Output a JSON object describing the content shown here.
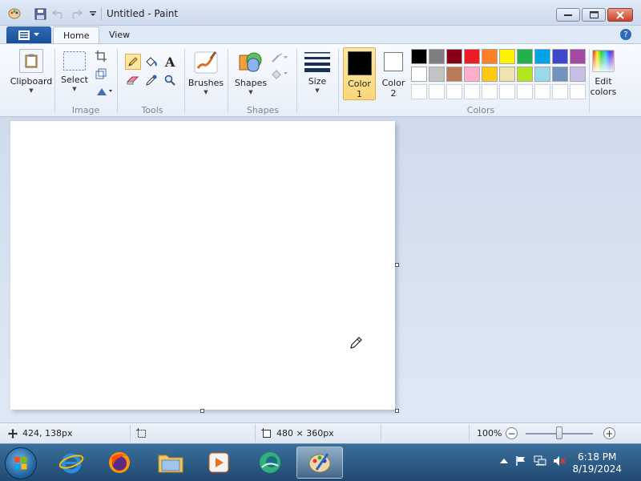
{
  "window": {
    "title": "Untitled - Paint"
  },
  "tabs": [
    {
      "label": "Home",
      "active": true
    },
    {
      "label": "View",
      "active": false
    }
  ],
  "ribbon": {
    "clipboard": {
      "label": "Clipboard"
    },
    "image": {
      "select_label": "Select",
      "group_label": "Image"
    },
    "tools": {
      "group_label": "Tools",
      "selected_tool": "pencil"
    },
    "brushes": {
      "label": "Brushes"
    },
    "shapes": {
      "label": "Shapes",
      "group_label": "Shapes"
    },
    "size": {
      "label": "Size"
    },
    "colors": {
      "color1_label": "Color\n1",
      "color2_label": "Color\n2",
      "color1_value": "#000000",
      "color2_value": "#ffffff",
      "edit_label": "Edit\ncolors",
      "group_label": "Colors",
      "palette_row1": [
        "#000000",
        "#7f7f7f",
        "#880015",
        "#ed1c24",
        "#ff7f27",
        "#fff200",
        "#22b14c",
        "#00a2e8",
        "#3f48cc",
        "#a349a4"
      ],
      "palette_row2": [
        "#ffffff",
        "#c3c3c3",
        "#b97a57",
        "#ffaec9",
        "#ffc90e",
        "#efe4b0",
        "#b5e61d",
        "#99d9ea",
        "#7092be",
        "#c8bfe7"
      ],
      "palette_row3": [
        "#ffffff",
        "#ffffff",
        "#ffffff",
        "#ffffff",
        "#ffffff",
        "#ffffff",
        "#ffffff",
        "#ffffff",
        "#ffffff",
        "#ffffff"
      ]
    }
  },
  "status": {
    "cursor_pos": "424, 138px",
    "canvas_size": "480 × 360px",
    "zoom": "100%",
    "zoom_level": 0.5
  },
  "taskbar": {
    "time": "6:18 PM",
    "date": "8/19/2024"
  }
}
